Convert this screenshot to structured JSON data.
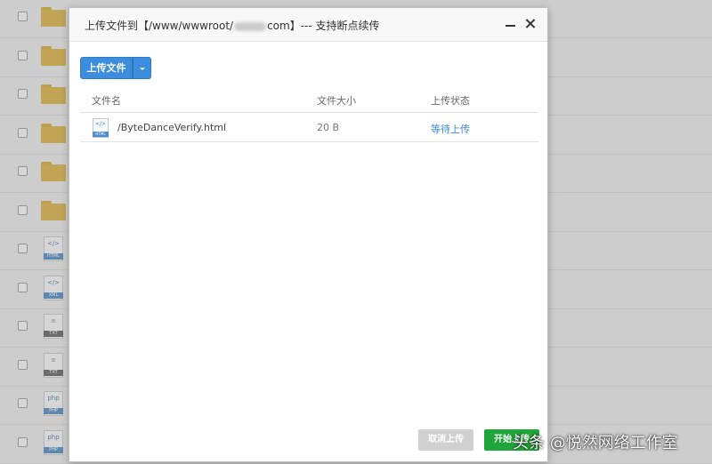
{
  "background": {
    "rows": [
      {
        "type": "folder"
      },
      {
        "type": "folder"
      },
      {
        "type": "folder"
      },
      {
        "type": "folder"
      },
      {
        "type": "folder"
      },
      {
        "type": "folder"
      },
      {
        "type": "file",
        "label": "HTML",
        "symbol": "</>"
      },
      {
        "type": "file",
        "label": "XML",
        "symbol": "</>"
      },
      {
        "type": "file",
        "label": "TXT",
        "symbol": "≡"
      },
      {
        "type": "file",
        "label": "TXT",
        "symbol": "≡"
      },
      {
        "type": "file",
        "label": "PHP",
        "symbol": "php"
      },
      {
        "type": "file",
        "label": "PHP",
        "symbol": "php"
      }
    ]
  },
  "dialog": {
    "title_prefix": "上传文件到【/www/wwwroot/",
    "title_suffix": "com】--- 支持断点续传",
    "upload_button": "上传文件",
    "columns": {
      "name": "文件名",
      "size": "文件大小",
      "status": "上传状态"
    },
    "files": [
      {
        "icon_label": "HTML",
        "icon_symbol": "</>",
        "name": "/ByteDanceVerify.html",
        "size": "20 B",
        "status": "等待上传"
      }
    ],
    "cancel_button": "取消上传",
    "start_button": "开始上传"
  },
  "watermark": "头条 @悦然网络工作室",
  "colors": {
    "primary": "#3c8ddd",
    "success": "#20a53a",
    "status_link": "#3b8ad6",
    "disabled": "#d0d0d0"
  }
}
